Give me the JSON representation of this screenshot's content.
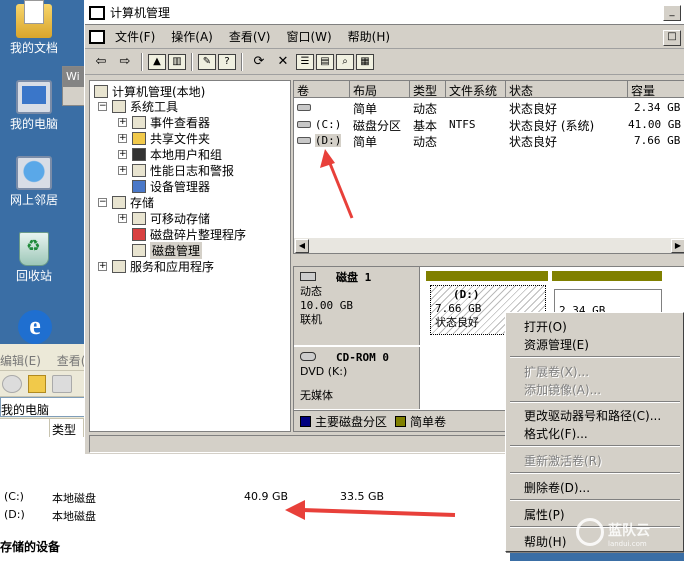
{
  "desktop": {
    "icons": [
      {
        "label": "我的文档",
        "icon": "folder-documents-icon"
      },
      {
        "label": "我的电脑",
        "icon": "computer-icon"
      },
      {
        "label": "网上邻居",
        "icon": "network-icon"
      },
      {
        "label": "回收站",
        "icon": "recycle-bin-icon"
      }
    ],
    "peek_window_title": "Wi"
  },
  "background_window": {
    "menu": [
      "编辑(E)",
      "查看(V)"
    ],
    "address_value": "我的电脑",
    "columns": [
      "类型"
    ],
    "rows": [
      {
        "drive": "(C:)",
        "type": "本地磁盘",
        "total": "40.9 GB",
        "free": "33.5 GB"
      },
      {
        "drive": "(D:)",
        "type": "本地磁盘",
        "total": "",
        "free": ""
      }
    ],
    "section_title": "存储的设备"
  },
  "mmc": {
    "title": "计算机管理",
    "menu": [
      "文件(F)",
      "操作(A)",
      "查看(V)",
      "窗口(W)",
      "帮助(H)"
    ],
    "tree": {
      "root": "计算机管理(本地)",
      "system_tools": "系统工具",
      "event_viewer": "事件查看器",
      "shared_folders": "共享文件夹",
      "local_users": "本地用户和组",
      "perf_logs": "性能日志和警报",
      "device_manager": "设备管理器",
      "storage": "存储",
      "removable": "可移动存储",
      "defrag": "磁盘碎片整理程序",
      "disk_mgmt": "磁盘管理",
      "services": "服务和应用程序"
    },
    "volume_list": {
      "columns": [
        "卷",
        "布局",
        "类型",
        "文件系统",
        "状态",
        "容量"
      ],
      "rows": [
        {
          "volume": "",
          "layout": "简单",
          "type": "动态",
          "fs": "",
          "status": "状态良好",
          "capacity": "2.34 GB"
        },
        {
          "volume": "(C:)",
          "layout": "磁盘分区",
          "type": "基本",
          "fs": "NTFS",
          "status": "状态良好 (系统)",
          "capacity": "41.00 GB"
        },
        {
          "volume": "(D:)",
          "layout": "简单",
          "type": "动态",
          "fs": "",
          "status": "状态良好",
          "capacity": "7.66 GB"
        }
      ]
    },
    "disks": {
      "disk1": {
        "title": "磁盘 1",
        "kind": "动态",
        "size": "10.00 GB",
        "state": "联机"
      },
      "disk1_part1": {
        "name": "(D:)",
        "size": "7.66 GB",
        "status": "状态良好"
      },
      "disk1_part2": {
        "size": "2.34 GB"
      },
      "cdrom": {
        "title": "CD-ROM 0",
        "kind": "DVD (K:)",
        "state": "无媒体"
      },
      "legend": [
        {
          "label": "主要磁盘分区",
          "color": "#000080"
        },
        {
          "label": "简单卷",
          "color": "#808000"
        }
      ]
    }
  },
  "context_menu": {
    "items": [
      {
        "label": "打开(O)",
        "enabled": true
      },
      {
        "label": "资源管理(E)",
        "enabled": true
      },
      {
        "label": "扩展卷(X)...",
        "enabled": false
      },
      {
        "label": "添加镜像(A)...",
        "enabled": false
      },
      {
        "label": "更改驱动器号和路径(C)...",
        "enabled": true
      },
      {
        "label": "格式化(F)...",
        "enabled": true
      },
      {
        "label": "重新激活卷(R)",
        "enabled": false
      },
      {
        "label": "删除卷(D)...",
        "enabled": true
      },
      {
        "label": "属性(P)",
        "enabled": true
      },
      {
        "label": "帮助(H)",
        "enabled": true
      }
    ]
  },
  "annotation_color": "#e8403a",
  "watermark": {
    "text": "蓝队云",
    "sub": "landui.com"
  }
}
